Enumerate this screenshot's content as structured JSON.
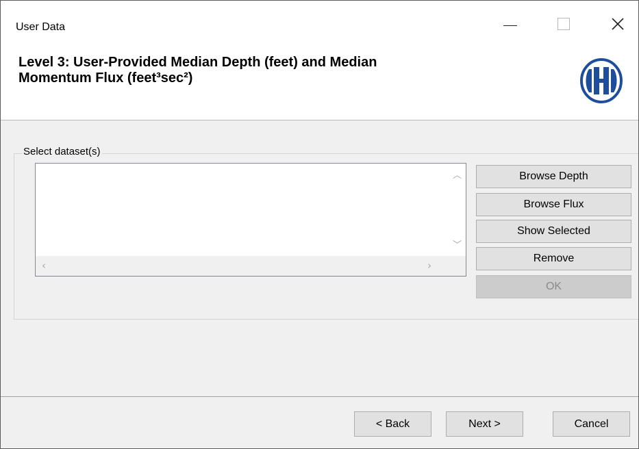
{
  "window": {
    "title": "User Data"
  },
  "header": {
    "title_line1": "Level 3: User-Provided Median Depth (feet) and Median",
    "title_line2": "Momentum Flux (feet³sec²)",
    "logo_icon": "hydraulics-h-logo-icon"
  },
  "dataset_group": {
    "label": "Select dataset(s)",
    "items": []
  },
  "actions": {
    "browse_depth": "Browse Depth",
    "browse_flux": "Browse Flux",
    "show_selected": "Show Selected",
    "remove": "Remove",
    "ok": "OK"
  },
  "footer": {
    "back": "< Back",
    "next": "Next >",
    "cancel": "Cancel"
  },
  "colors": {
    "logo_blue": "#1e4d9b",
    "disabled_bg": "#cccccc"
  }
}
